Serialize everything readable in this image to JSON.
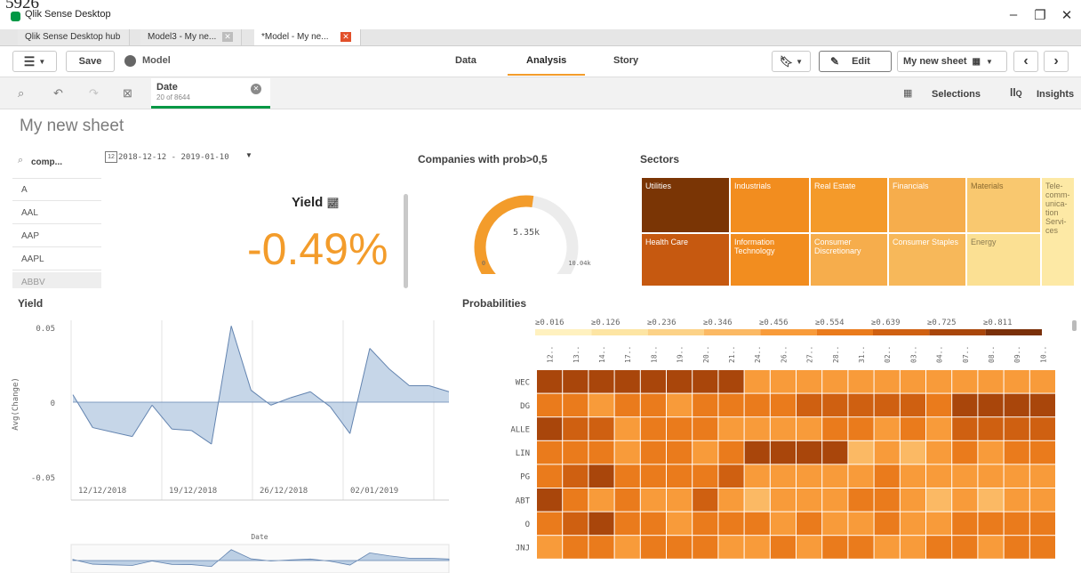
{
  "page_number": "5926",
  "window": {
    "title": "Qlik Sense Desktop",
    "controls": [
      "–",
      "❐",
      "✕"
    ]
  },
  "tabs": [
    {
      "label": "Qlik Sense Desktop hub",
      "closable": false
    },
    {
      "label": "Model3 - My ne...",
      "closable": true
    },
    {
      "label": "*Model - My ne...",
      "closable": true,
      "active": true
    }
  ],
  "toolbar": {
    "menu_icon": "hamburger-icon",
    "save_label": "Save",
    "app_name": "Model",
    "nav": [
      "Data",
      "Analysis",
      "Story"
    ],
    "active_nav": "Analysis",
    "edit_label": "Edit",
    "sheet_name": "My new sheet",
    "prev_icon": "chevron-left-icon",
    "next_icon": "chevron-right-icon"
  },
  "selection_bar": {
    "field": "Date",
    "count": "20 of 8644",
    "selections_label": "Selections",
    "insights_label": "Insights"
  },
  "sheet": {
    "title": "My new sheet",
    "search_label": "comp...",
    "date_range": "2018-12-12 - 2019-01-10",
    "listbox": [
      "A",
      "AAL",
      "AAP",
      "AAPL",
      "ABBV"
    ]
  },
  "kpi": {
    "title": "Yield",
    "value": "-0.49%",
    "color": "#f39c2b"
  },
  "gauge": {
    "title": "Companies with prob>0,5",
    "value": "5.35k",
    "min": "0",
    "max": "10.04k",
    "fill_fraction": 0.53,
    "color": "#f39c2b"
  },
  "sectors": {
    "title": "Sectors",
    "cells": [
      {
        "label": "Utilities",
        "color": "#7a3505"
      },
      {
        "label": "Industrials",
        "color": "#f28d1f"
      },
      {
        "label": "Real Estate",
        "color": "#f49a2a"
      },
      {
        "label": "Financials",
        "color": "#f6ad4c"
      },
      {
        "label": "Materials",
        "color": "#f9c86f"
      },
      {
        "label": "Tele-comm-unica-tion Servi-ces",
        "color": "#fde9a5"
      },
      {
        "label": "Health Care",
        "color": "#c65910"
      },
      {
        "label": "Information Technology",
        "color": "#f28d1f"
      },
      {
        "label": "Consumer Discretionary",
        "color": "#f6ad4c"
      },
      {
        "label": "Consumer Staples",
        "color": "#f7b85a"
      },
      {
        "label": "Energy",
        "color": "#fbe093"
      }
    ]
  },
  "yield_chart": {
    "title": "Yield",
    "ylabel": "Avg(Change)",
    "yticks": [
      "0.05",
      "0",
      "-0.05"
    ],
    "xticks": [
      "12/12/2018",
      "19/12/2018",
      "26/12/2018",
      "02/01/2019"
    ],
    "scrub_label": "Date",
    "fill": "#bccfe4",
    "line": "#6384b0"
  },
  "chart_data": {
    "type": "area",
    "title": "Yield",
    "ylabel": "Avg(Change)",
    "ylim": [
      -0.05,
      0.05
    ],
    "x": [
      "2018-12-12",
      "2018-12-13",
      "2018-12-14",
      "2018-12-17",
      "2018-12-18",
      "2018-12-19",
      "2018-12-20",
      "2018-12-21",
      "2018-12-24",
      "2018-12-26",
      "2018-12-27",
      "2018-12-28",
      "2018-12-31",
      "2019-01-02",
      "2019-01-03",
      "2019-01-04",
      "2019-01-07",
      "2019-01-08",
      "2019-01-09",
      "2019-01-10"
    ],
    "values": [
      0.005,
      -0.017,
      -0.02,
      -0.023,
      -0.002,
      -0.018,
      -0.019,
      -0.028,
      0.051,
      0.008,
      -0.002,
      0.003,
      0.007,
      -0.003,
      -0.021,
      0.036,
      0.022,
      0.011,
      0.011,
      0.007
    ]
  },
  "heatmap": {
    "title": "Probabilities",
    "legend": [
      "≥0.016",
      "≥0.126",
      "≥0.236",
      "≥0.346",
      "≥0.456",
      "≥0.554",
      "≥0.639",
      "≥0.725",
      "≥0.811"
    ],
    "legend_colors": [
      "#fff1bf",
      "#fde5a3",
      "#fcd287",
      "#fbb964",
      "#f89b3a",
      "#ea7b1c",
      "#cf6011",
      "#a9460b",
      "#7a300a"
    ],
    "columns": [
      "12..",
      "13..",
      "14..",
      "17..",
      "18..",
      "19..",
      "20..",
      "21..",
      "24..",
      "26..",
      "27..",
      "28..",
      "31..",
      "02..",
      "03..",
      "04..",
      "07..",
      "08..",
      "09..",
      "10.."
    ],
    "rows": [
      {
        "label": "WEC",
        "levels": [
          7,
          7,
          7,
          7,
          7,
          7,
          7,
          7,
          4,
          4,
          4,
          4,
          4,
          4,
          4,
          4,
          4,
          4,
          4,
          4
        ]
      },
      {
        "label": "DG",
        "levels": [
          5,
          5,
          4,
          5,
          5,
          4,
          5,
          5,
          5,
          5,
          6,
          6,
          6,
          6,
          6,
          5,
          7,
          7,
          7,
          7
        ]
      },
      {
        "label": "ALLE",
        "levels": [
          7,
          6,
          6,
          4,
          5,
          5,
          5,
          4,
          4,
          4,
          4,
          5,
          5,
          4,
          5,
          4,
          6,
          6,
          6,
          6
        ]
      },
      {
        "label": "LIN",
        "levels": [
          5,
          5,
          5,
          4,
          5,
          5,
          4,
          5,
          7,
          7,
          7,
          7,
          3,
          4,
          3,
          4,
          5,
          4,
          5,
          5
        ]
      },
      {
        "label": "PG",
        "levels": [
          5,
          6,
          7,
          5,
          5,
          5,
          5,
          6,
          4,
          4,
          4,
          4,
          4,
          5,
          4,
          4,
          4,
          4,
          4,
          4
        ]
      },
      {
        "label": "ABT",
        "levels": [
          7,
          5,
          4,
          5,
          4,
          4,
          6,
          4,
          3,
          4,
          4,
          4,
          5,
          5,
          4,
          3,
          4,
          3,
          4,
          4
        ]
      },
      {
        "label": "O",
        "levels": [
          5,
          6,
          7,
          5,
          5,
          4,
          5,
          5,
          5,
          4,
          5,
          4,
          4,
          5,
          4,
          4,
          5,
          5,
          5,
          5
        ]
      },
      {
        "label": "JNJ",
        "levels": [
          4,
          5,
          5,
          4,
          5,
          5,
          5,
          4,
          4,
          5,
          4,
          5,
          5,
          4,
          4,
          5,
          5,
          4,
          5,
          5
        ]
      }
    ]
  }
}
